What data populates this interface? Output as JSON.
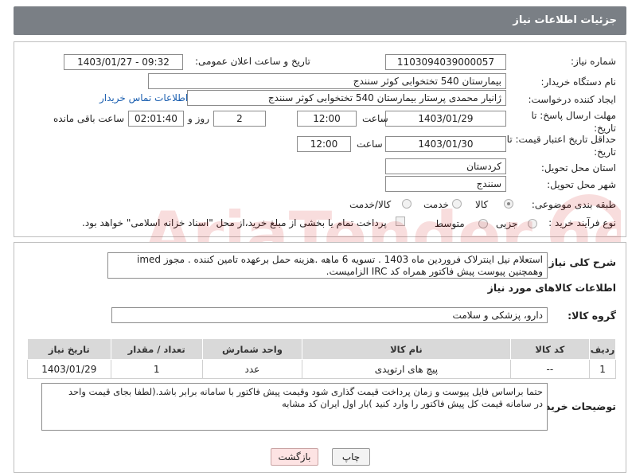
{
  "header": {
    "title": "جزئیات اطلاعات نیاز"
  },
  "form": {
    "need_number_label": "شماره نیاز:",
    "need_number": "1103094039000057",
    "announce_label": "تاریخ و ساعت اعلان عمومی:",
    "announce_value": "1403/01/27 - 09:32",
    "buyer_label": "نام دستگاه خریدار:",
    "buyer_value": "بیمارستان 540 تختخوابی کوثر سنندج",
    "creator_label": "ایجاد کننده درخواست:",
    "creator_value": "ژانیار محمدی پرستار بیمارستان 540 تختخوابی کوثر سنندج",
    "contact_link": "اطلاعات تماس خریدار",
    "deadline_label": "مهلت ارسال پاسخ: تا تاریخ:",
    "deadline_date": "1403/01/29",
    "time_label": "ساعت",
    "deadline_time": "12:00",
    "days_value": "2",
    "days_label": "روز و",
    "remaining_value": "02:01:40",
    "remaining_label": "ساعت باقی مانده",
    "validity_label": "حداقل تاریخ اعتبار قیمت: تا تاریخ:",
    "validity_date": "1403/01/30",
    "validity_time_label": "ساعت",
    "validity_time": "12:00",
    "province_label": "استان محل تحویل:",
    "province_value": "کردستان",
    "city_label": "شهر محل تحویل:",
    "city_value": "سنندج",
    "category_label": "طبقه بندی موضوعی:",
    "category_options": [
      "کالا",
      "خدمت",
      "کالا/خدمت"
    ],
    "category_selected": "کالا",
    "process_label": "نوع فرآیند خرید :",
    "process_options": [
      "جزیی",
      "متوسط"
    ],
    "process_note": "پرداخت تمام یا بخشی از مبلغ خرید،از محل \"اسناد خزانه اسلامی\" خواهد بود."
  },
  "description": {
    "label": "شرح کلی نیاز:",
    "text_line1": "استعلام نیل اینترلاک فروردین ماه 1403 . تسویه 6 ماهه .هزینه حمل برعهده تامین کننده . مجوز imed",
    "text_line2": "وهمچنین پیوست پیش فاکتور همراه کد IRC  الزامیست."
  },
  "goods_section": {
    "title": "اطلاعات کالاهای مورد نیاز",
    "group_label": "گروه کالا:",
    "group_value": "دارو، پزشکی و سلامت"
  },
  "table": {
    "headers": [
      "ردیف",
      "کد کالا",
      "نام کالا",
      "واحد شمارش",
      "تعداد / مقدار",
      "تاریخ نیاز"
    ],
    "rows": [
      [
        "1",
        "--",
        "پیچ های ارتوپدی",
        "عدد",
        "1",
        "1403/01/29"
      ]
    ]
  },
  "buyer_notes": {
    "label": "توضیحات خریدار:",
    "line1": "حتما براساس فایل پیوست  و زمان پرداخت قیمت گذاری شود وقیمت پیش فاکتور با سامانه برابر باشد.(لطفا بجای قیمت واحد",
    "line2": "در سامانه قیمت کل پیش فاکتور را وارد کنید )بار اول ایران کد مشابه"
  },
  "buttons": {
    "print": "چاپ",
    "back": "بازگشت"
  },
  "watermark": {
    "text": "AriaTender.net"
  },
  "colors": {
    "header_bg": "#7a7f85",
    "link": "#1b5fb0",
    "back_button": "#fde3e3"
  }
}
